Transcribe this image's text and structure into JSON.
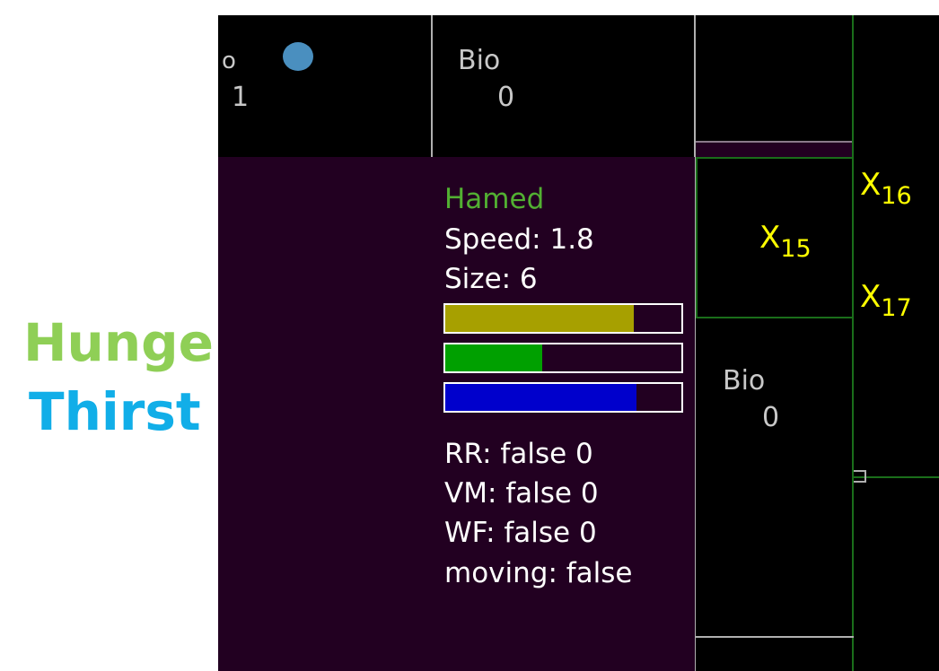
{
  "legend": {
    "hunger": "Hunge",
    "thirst": "Thirst",
    "hunger_color": "#8fcf56",
    "thirst_color": "#11aee8"
  },
  "cells": {
    "top_left": {
      "label": "o",
      "value": "1"
    },
    "top_middle": {
      "label": "Bio",
      "value": "0"
    },
    "right_middle": {
      "label": "Bio",
      "value": "0"
    }
  },
  "creature": {
    "name": "Hamed",
    "speed": "Speed: 1.8",
    "size": "Size: 6",
    "bars": [
      {
        "name": "yellow-bar",
        "color": "#a7a000",
        "fill": 0.8
      },
      {
        "name": "green-bar",
        "color": "#00a000",
        "fill": 0.41
      },
      {
        "name": "blue-bar",
        "color": "#0000cc",
        "fill": 0.81
      }
    ],
    "flags": [
      "RR: false 0",
      "VM: false 0",
      "WF: false 0",
      "moving: false"
    ],
    "name_color": "#52b032"
  },
  "markers": [
    {
      "symbol": "X",
      "index": "15"
    },
    {
      "symbol": "X",
      "index": "16"
    },
    {
      "symbol": "X",
      "index": "17"
    }
  ],
  "colors": {
    "panel_bg": "#220021",
    "marker": "#ffff00",
    "food_dot": "#4a8fbf"
  }
}
